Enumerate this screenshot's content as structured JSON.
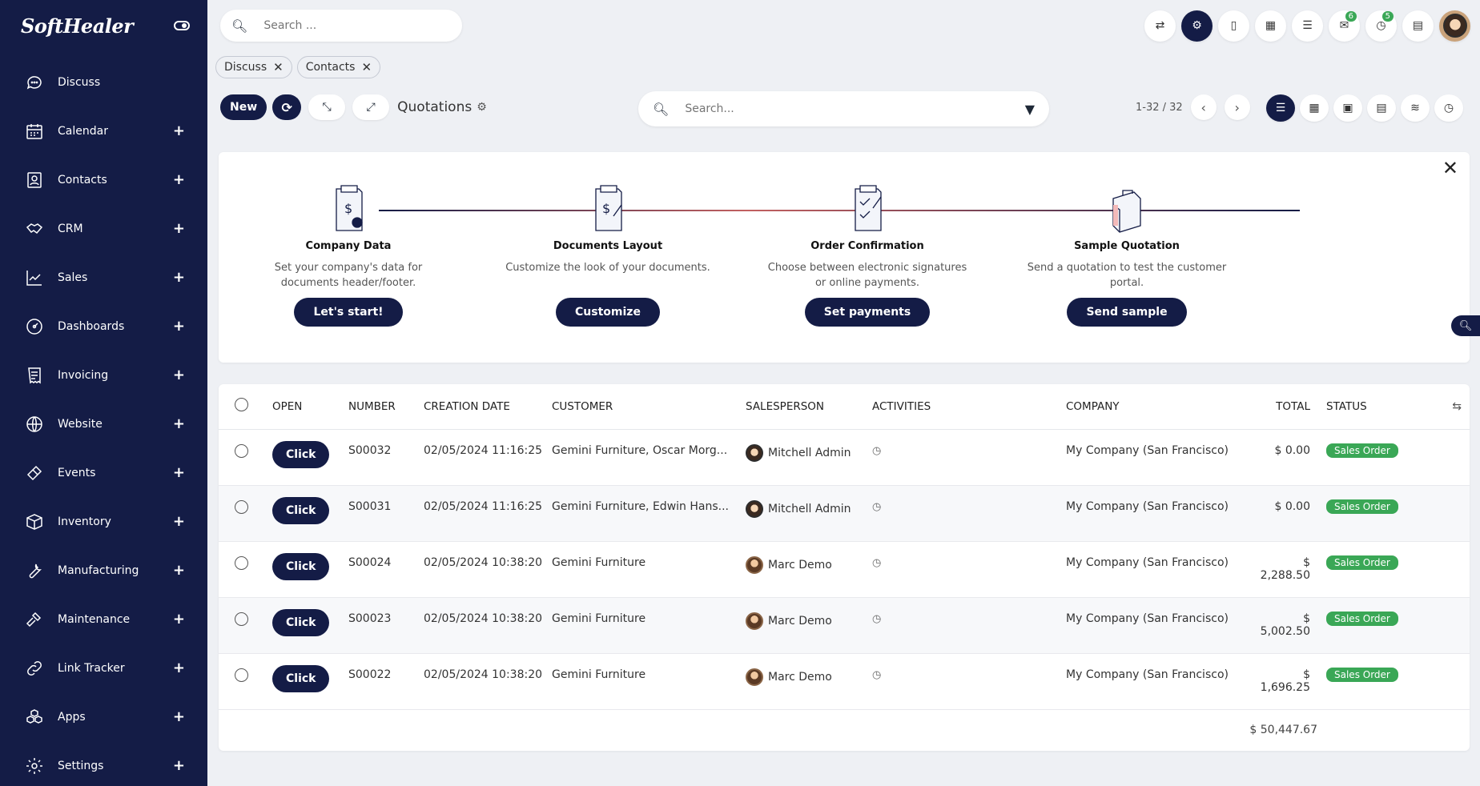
{
  "brand": {
    "logo": "SoftHealer"
  },
  "sidebar": {
    "items": [
      {
        "label": "Discuss",
        "icon": "chat-icon",
        "plus": ""
      },
      {
        "label": "Calendar",
        "icon": "calendar-icon",
        "plus": "+"
      },
      {
        "label": "Contacts",
        "icon": "contact-card-icon",
        "plus": "+"
      },
      {
        "label": "CRM",
        "icon": "handshake-icon",
        "plus": "+"
      },
      {
        "label": "Sales",
        "icon": "chart-line-icon",
        "plus": "+"
      },
      {
        "label": "Dashboards",
        "icon": "gauge-icon",
        "plus": "+"
      },
      {
        "label": "Invoicing",
        "icon": "invoice-icon",
        "plus": "+"
      },
      {
        "label": "Website",
        "icon": "globe-icon",
        "plus": "+"
      },
      {
        "label": "Events",
        "icon": "ticket-icon",
        "plus": "+"
      },
      {
        "label": "Inventory",
        "icon": "box-icon",
        "plus": "+"
      },
      {
        "label": "Manufacturing",
        "icon": "wrench-icon",
        "plus": "+"
      },
      {
        "label": "Maintenance",
        "icon": "hammer-icon",
        "plus": "+"
      },
      {
        "label": "Link Tracker",
        "icon": "link-icon",
        "plus": "+"
      },
      {
        "label": "Apps",
        "icon": "cubes-icon",
        "plus": "+"
      },
      {
        "label": "Settings",
        "icon": "gear-icon",
        "plus": "+"
      }
    ]
  },
  "topbar": {
    "search_placeholder": "Search ...",
    "icons": [
      {
        "name": "language-icon",
        "glyph": "⇄",
        "badge": ""
      },
      {
        "name": "settings-icon",
        "glyph": "⚙",
        "badge": "",
        "active": true
      },
      {
        "name": "bookmark-icon",
        "glyph": "▯",
        "badge": ""
      },
      {
        "name": "calculator-icon",
        "glyph": "▦",
        "badge": ""
      },
      {
        "name": "list-icon",
        "glyph": "☰",
        "badge": ""
      },
      {
        "name": "messages-icon",
        "glyph": "✉",
        "badge": "6"
      },
      {
        "name": "activity-clock-icon",
        "glyph": "◷",
        "badge": "5"
      },
      {
        "name": "company-icon",
        "glyph": "▤",
        "badge": ""
      }
    ]
  },
  "breadcrumbs": [
    {
      "label": "Discuss"
    },
    {
      "label": "Contacts"
    }
  ],
  "controls": {
    "new_label": "New",
    "view_title": "Quotations",
    "search_placeholder": "Search...",
    "pager": "1-32 / 32"
  },
  "onboarding": {
    "steps": [
      {
        "title": "Company Data",
        "desc": "Set your company's data for documents header/footer.",
        "button": "Let's start!"
      },
      {
        "title": "Documents Layout",
        "desc": "Customize the look of your documents.",
        "button": "Customize"
      },
      {
        "title": "Order Confirmation",
        "desc": "Choose between electronic signatures or online payments.",
        "button": "Set payments"
      },
      {
        "title": "Sample Quotation",
        "desc": "Send a quotation to test the customer portal.",
        "button": "Send sample"
      }
    ]
  },
  "table": {
    "headers": {
      "open": "OPEN",
      "number": "NUMBER",
      "date": "CREATION DATE",
      "customer": "CUSTOMER",
      "salesperson": "SALESPERSON",
      "activities": "ACTIVITIES",
      "company": "COMPANY",
      "total": "TOTAL",
      "status": "STATUS"
    },
    "click_label": "Click",
    "rows": [
      {
        "number": "S00032",
        "date": "02/05/2024 11:16:25",
        "customer": "Gemini Furniture, Oscar Morg...",
        "salesperson": "Mitchell Admin",
        "avatar": "mitchell",
        "company": "My Company (San Francisco)",
        "total": "$ 0.00",
        "status": "Sales Order"
      },
      {
        "number": "S00031",
        "date": "02/05/2024 11:16:25",
        "customer": "Gemini Furniture, Edwin Hans...",
        "salesperson": "Mitchell Admin",
        "avatar": "mitchell",
        "company": "My Company (San Francisco)",
        "total": "$ 0.00",
        "status": "Sales Order"
      },
      {
        "number": "S00024",
        "date": "02/05/2024 10:38:20",
        "customer": "Gemini Furniture",
        "salesperson": "Marc Demo",
        "avatar": "marc",
        "company": "My Company (San Francisco)",
        "total": "$ 2,288.50",
        "status": "Sales Order"
      },
      {
        "number": "S00023",
        "date": "02/05/2024 10:38:20",
        "customer": "Gemini Furniture",
        "salesperson": "Marc Demo",
        "avatar": "marc",
        "company": "My Company (San Francisco)",
        "total": "$ 5,002.50",
        "status": "Sales Order"
      },
      {
        "number": "S00022",
        "date": "02/05/2024 10:38:20",
        "customer": "Gemini Furniture",
        "salesperson": "Marc Demo",
        "avatar": "marc",
        "company": "My Company (San Francisco)",
        "total": "$ 1,696.25",
        "status": "Sales Order"
      }
    ],
    "sum_total": "$ 50,447.67"
  },
  "colors": {
    "sidebar": "#141c46",
    "accent": "#141c46",
    "status_green": "#3aa756"
  }
}
